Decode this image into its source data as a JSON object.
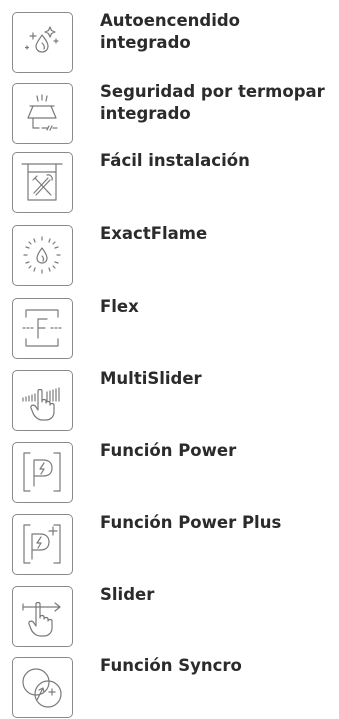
{
  "features": [
    {
      "label": "Autoencendido integrado",
      "icon": "auto-ignition-icon"
    },
    {
      "label": "Seguridad por termopar integrado",
      "icon": "thermocouple-icon"
    },
    {
      "label": "Fácil instalación",
      "icon": "easy-installation-icon"
    },
    {
      "label": "ExactFlame",
      "icon": "exactflame-icon"
    },
    {
      "label": "Flex",
      "icon": "flex-zone-icon"
    },
    {
      "label": "MultiSlider",
      "icon": "multislider-icon"
    },
    {
      "label": "Función Power",
      "icon": "power-function-icon"
    },
    {
      "label": "Función Power Plus",
      "icon": "power-plus-icon"
    },
    {
      "label": "Slider",
      "icon": "slider-icon"
    },
    {
      "label": "Función Syncro",
      "icon": "syncro-icon"
    }
  ]
}
